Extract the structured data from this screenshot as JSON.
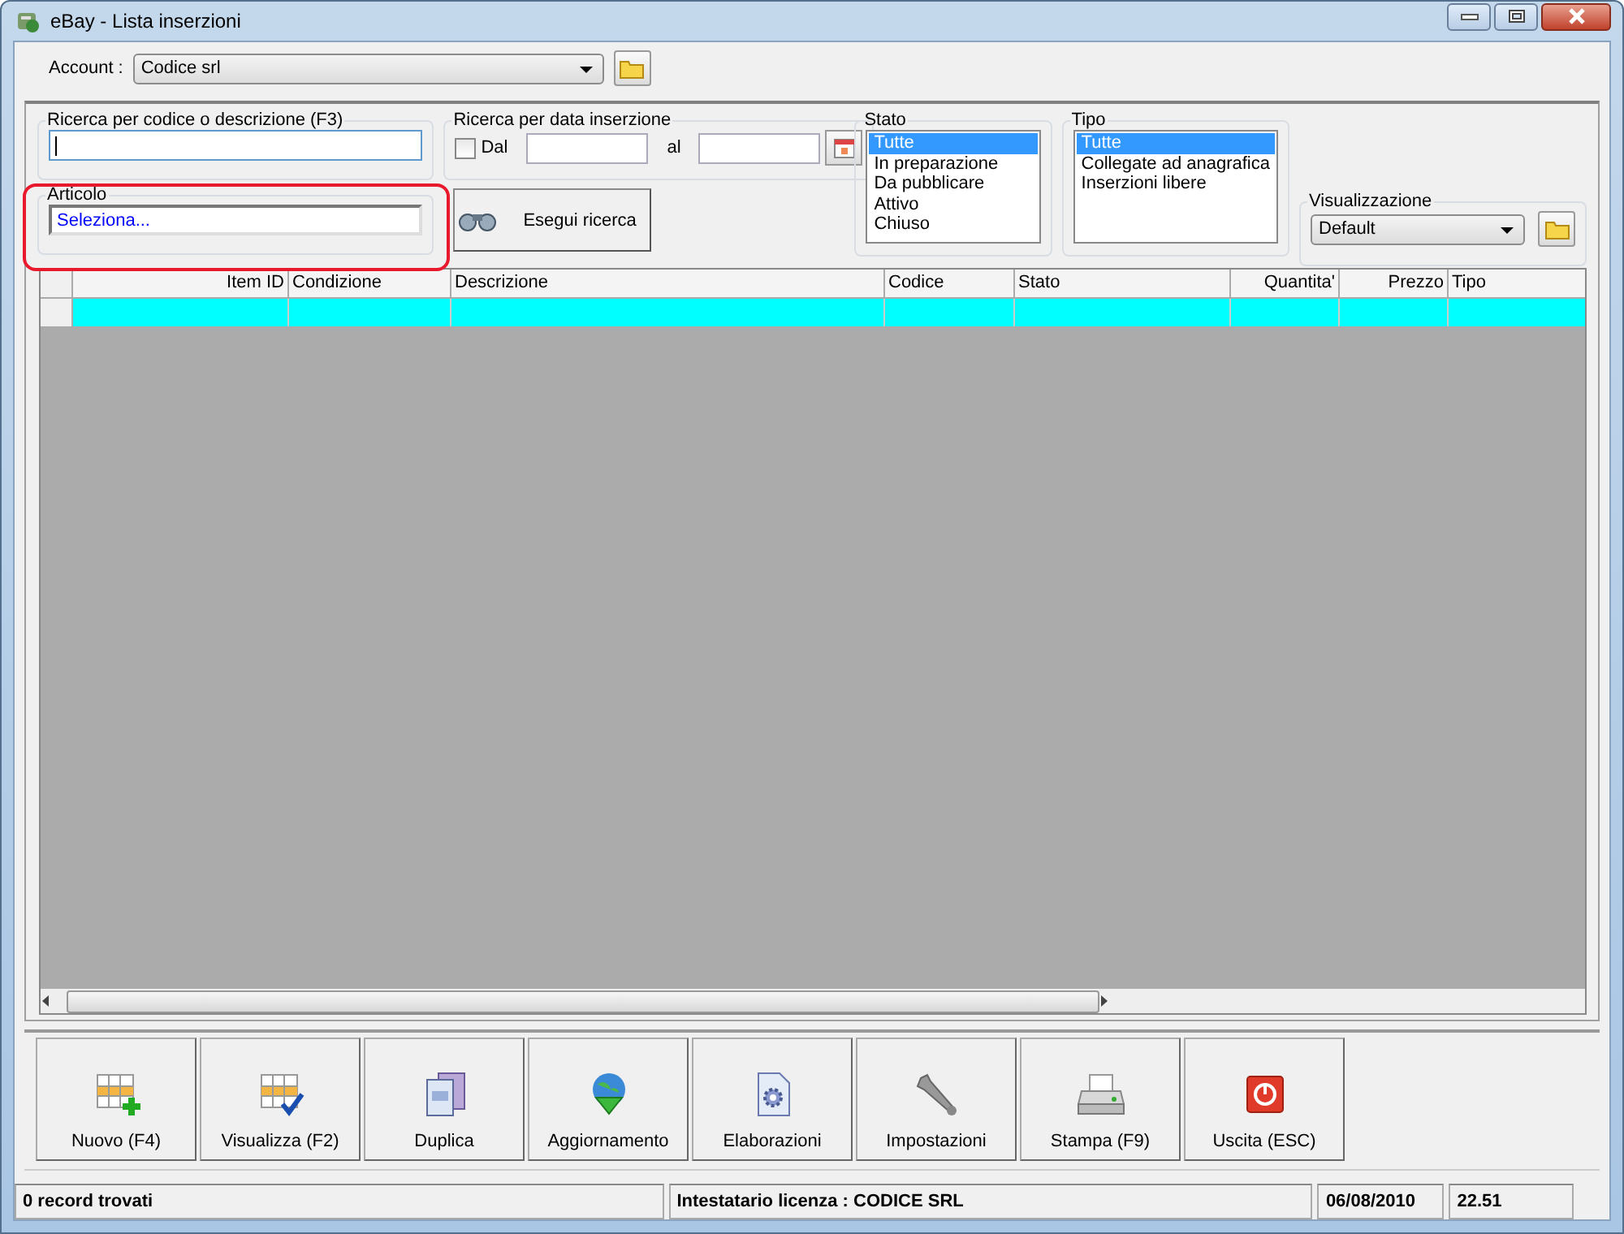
{
  "window": {
    "title": "eBay - Lista inserzioni"
  },
  "account": {
    "label": "Account :",
    "value": "Codice srl"
  },
  "search_code": {
    "legend": "Ricerca per codice o descrizione (F3)"
  },
  "articolo": {
    "legend": "Articolo",
    "value": "Seleziona..."
  },
  "date_search": {
    "legend": "Ricerca per data inserzione",
    "checkbox": {
      "label": "Dal",
      "checked": false
    },
    "to_label": "al"
  },
  "search_button": {
    "label": "Esegui ricerca"
  },
  "stato": {
    "legend": "Stato",
    "items": [
      {
        "label": "Tutte",
        "selected": true
      },
      {
        "label": "In preparazione",
        "selected": false
      },
      {
        "label": "Da pubblicare",
        "selected": false
      },
      {
        "label": "Attivo",
        "selected": false
      },
      {
        "label": "Chiuso",
        "selected": false
      }
    ]
  },
  "tipo": {
    "legend": "Tipo",
    "items": [
      {
        "label": "Tutte",
        "selected": true
      },
      {
        "label": "Collegate ad anagrafica",
        "selected": false
      },
      {
        "label": "Inserzioni libere",
        "selected": false
      }
    ]
  },
  "visualizzazione": {
    "legend": "Visualizzazione",
    "value": "Default"
  },
  "table": {
    "columns": [
      "Item ID",
      "Condizione",
      "Descrizione",
      "Codice",
      "Stato",
      "Quantita'",
      "Prezzo",
      "Tipo"
    ]
  },
  "toolbar": [
    {
      "label": "Nuovo (F4)",
      "kind": "new"
    },
    {
      "label": "Visualizza (F2)",
      "kind": "view"
    },
    {
      "label": "Duplica",
      "kind": "copy"
    },
    {
      "label": "Aggiornamento",
      "kind": "update"
    },
    {
      "label": "Elaborazioni",
      "kind": "process"
    },
    {
      "label": "Impostazioni",
      "kind": "settings"
    },
    {
      "label": "Stampa (F9)",
      "kind": "print"
    },
    {
      "label": "Uscita (ESC)",
      "kind": "exit"
    }
  ],
  "status_bar": {
    "records": "0 record trovati",
    "license": "Intestatario licenza : CODICE SRL",
    "date": "06/08/2010",
    "time": "22.51"
  }
}
